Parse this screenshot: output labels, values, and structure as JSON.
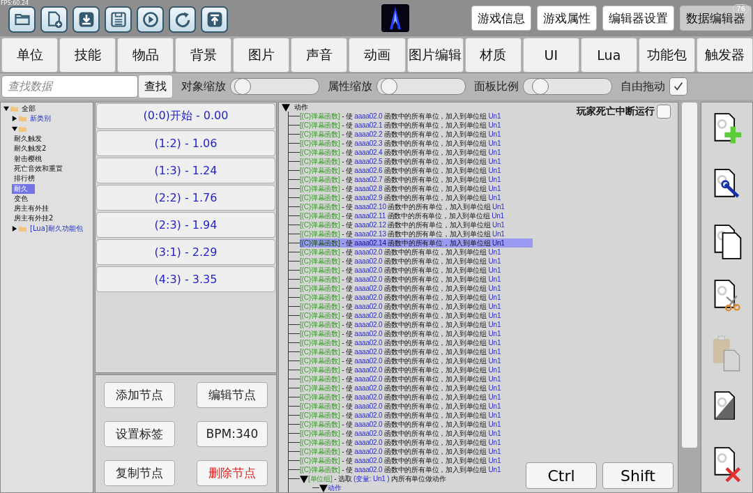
{
  "fps": "FPS:60.24",
  "toolbar": {
    "badge": "76",
    "tool_buttons": [
      {
        "kind": "folder"
      },
      {
        "kind": "new-file"
      },
      {
        "kind": "download"
      },
      {
        "kind": "save"
      },
      {
        "kind": "play"
      },
      {
        "kind": "refresh"
      },
      {
        "kind": "upload"
      }
    ],
    "nav_buttons": [
      {
        "label": "游戏信息",
        "selected": false
      },
      {
        "label": "游戏属性",
        "selected": false
      },
      {
        "label": "编辑器设置",
        "selected": false
      },
      {
        "label": "数据编辑器",
        "selected": true
      }
    ]
  },
  "tabs": [
    {
      "label": "单位",
      "selected": false
    },
    {
      "label": "技能",
      "selected": false
    },
    {
      "label": "物品",
      "selected": false
    },
    {
      "label": "背景",
      "selected": false
    },
    {
      "label": "图片",
      "selected": false
    },
    {
      "label": "声音",
      "selected": false
    },
    {
      "label": "动画",
      "selected": false
    },
    {
      "label": "图片编辑",
      "selected": false
    },
    {
      "label": "材质",
      "selected": false
    },
    {
      "label": "UI",
      "selected": false
    },
    {
      "label": "Lua",
      "selected": false
    },
    {
      "label": "功能包",
      "selected": false
    },
    {
      "label": "触发器",
      "selected": false
    }
  ],
  "search": {
    "placeholder": "查找数据",
    "button": "查找"
  },
  "sliders": [
    {
      "label": "对象缩放",
      "level": 0.05
    },
    {
      "label": "属性缩放",
      "level": 0.05
    },
    {
      "label": "面板比例",
      "level": 0.12
    }
  ],
  "free_drag": {
    "label": "自由拖动",
    "checked": true
  },
  "tree": [
    {
      "label": "全部",
      "kind": "folder",
      "expanded": true,
      "selected": false,
      "children": [
        {
          "label": "新类别",
          "expanded": false,
          "kind": "folder",
          "selected": false
        },
        {
          "expanded": true,
          "kind": "folder",
          "selected": false,
          "children": [
            {
              "label": "耐久触发",
              "selected": false
            },
            {
              "label": "耐久触发2",
              "selected": false
            },
            {
              "label": "射击樱桃",
              "selected": false
            },
            {
              "label": "死亡音效和重置",
              "selected": false
            },
            {
              "label": "排行榜",
              "selected": false
            },
            {
              "label": "耐久",
              "selected": true
            },
            {
              "label": "变色",
              "selected": false
            },
            {
              "label": "房主有外挂",
              "selected": false
            },
            {
              "label": "房主有外挂2",
              "selected": false
            }
          ]
        },
        {
          "label": "[Lua]耐久功能包",
          "expanded": false,
          "kind": "folder",
          "selected": false
        }
      ]
    }
  ],
  "nodes": [
    "(0:0)开始 - 0.00",
    "(1:2) - 1.06",
    "(1:3) - 1.24",
    "(2:2) - 1.76",
    "(2:3) - 1.94",
    "(3:1) - 2.29",
    "(4:3) - 3.35"
  ],
  "node_buttons": [
    {
      "label": "添加节点",
      "kind": "normal"
    },
    {
      "label": "编辑节点",
      "kind": "normal"
    },
    {
      "label": "设置标签",
      "kind": "normal"
    },
    {
      "label": "BPM:340",
      "kind": "normal"
    },
    {
      "label": "复制节点",
      "kind": "normal"
    },
    {
      "label": "删除节点",
      "kind": "danger"
    }
  ],
  "trigger": {
    "header": "动作",
    "stop_on_death": {
      "label": "玩家死亡中断运行",
      "checked": false
    },
    "rows": [
      {
        "tag": "[(C)弹幕函数]",
        "verb": " - 使 ",
        "target": "aaaa02.0",
        "rest": " 函数中的所有单位，加入到单位组 ",
        "group": "Un1",
        "selected": false
      },
      {
        "tag": "[(C)弹幕函数]",
        "verb": " - 使 ",
        "target": "aaaa02.1",
        "rest": " 函数中的所有单位，加入到单位组 ",
        "group": "Un1",
        "selected": false
      },
      {
        "tag": "[(C)弹幕函数]",
        "verb": " - 使 ",
        "target": "aaaa02.2",
        "rest": " 函数中的所有单位，加入到单位组 ",
        "group": "Un1",
        "selected": false
      },
      {
        "tag": "[(C)弹幕函数]",
        "verb": " - 使 ",
        "target": "aaaa02.3",
        "rest": " 函数中的所有单位，加入到单位组 ",
        "group": "Un1",
        "selected": false
      },
      {
        "tag": "[(C)弹幕函数]",
        "verb": " - 使 ",
        "target": "aaaa02.4",
        "rest": " 函数中的所有单位，加入到单位组 ",
        "group": "Un1",
        "selected": false
      },
      {
        "tag": "[(C)弹幕函数]",
        "verb": " - 使 ",
        "target": "aaaa02.5",
        "rest": " 函数中的所有单位，加入到单位组 ",
        "group": "Un1",
        "selected": false
      },
      {
        "tag": "[(C)弹幕函数]",
        "verb": " - 使 ",
        "target": "aaaa02.6",
        "rest": " 函数中的所有单位，加入到单位组 ",
        "group": "Un1",
        "selected": false
      },
      {
        "tag": "[(C)弹幕函数]",
        "verb": " - 使 ",
        "target": "aaaa02.7",
        "rest": " 函数中的所有单位，加入到单位组 ",
        "group": "Un1",
        "selected": false
      },
      {
        "tag": "[(C)弹幕函数]",
        "verb": " - 使 ",
        "target": "aaaa02.8",
        "rest": " 函数中的所有单位，加入到单位组 ",
        "group": "Un1",
        "selected": false
      },
      {
        "tag": "[(C)弹幕函数]",
        "verb": " - 使 ",
        "target": "aaaa02.9",
        "rest": " 函数中的所有单位，加入到单位组 ",
        "group": "Un1",
        "selected": false
      },
      {
        "tag": "[(C)弹幕函数]",
        "verb": " - 使 ",
        "target": "aaaa02.10",
        "rest": " 函数中的所有单位，加入到单位组 ",
        "group": "Un1",
        "selected": false
      },
      {
        "tag": "[(C)弹幕函数]",
        "verb": " - 使 ",
        "target": "aaaa02.11",
        "rest": " 函数中的所有单位，加入到单位组 ",
        "group": "Un1",
        "selected": false
      },
      {
        "tag": "[(C)弹幕函数]",
        "verb": " - 使 ",
        "target": "aaaa02.12",
        "rest": " 函数中的所有单位，加入到单位组 ",
        "group": "Un1",
        "selected": false
      },
      {
        "tag": "[(C)弹幕函数]",
        "verb": " - 使 ",
        "target": "aaaa02.13",
        "rest": " 函数中的所有单位，加入到单位组 ",
        "group": "Un1",
        "selected": false
      },
      {
        "tag": "[(C)弹幕函数]",
        "verb": " - 使 ",
        "target": "aaaa02.14",
        "rest": " 函数中的所有单位，加入到单位组 ",
        "group": "Un1",
        "selected": true
      },
      {
        "tag": "[(C)弹幕函数]",
        "verb": " - 使 ",
        "target": "aaaa02.0",
        "rest": " 函数中的所有单位，加入到单位组 ",
        "group": "Un1",
        "selected": false
      },
      {
        "tag": "[(C)弹幕函数]",
        "verb": " - 使 ",
        "target": "aaaa02.0",
        "rest": " 函数中的所有单位，加入到单位组 ",
        "group": "Un1",
        "selected": false
      },
      {
        "tag": "[(C)弹幕函数]",
        "verb": " - 使 ",
        "target": "aaaa02.0",
        "rest": " 函数中的所有单位，加入到单位组 ",
        "group": "Un1",
        "selected": false
      },
      {
        "tag": "[(C)弹幕函数]",
        "verb": " - 使 ",
        "target": "aaaa02.0",
        "rest": " 函数中的所有单位，加入到单位组 ",
        "group": "Un1",
        "selected": false
      },
      {
        "tag": "[(C)弹幕函数]",
        "verb": " - 使 ",
        "target": "aaaa02.0",
        "rest": " 函数中的所有单位，加入到单位组 ",
        "group": "Un1",
        "selected": false
      },
      {
        "tag": "[(C)弹幕函数]",
        "verb": " - 使 ",
        "target": "aaaa02.0",
        "rest": " 函数中的所有单位，加入到单位组 ",
        "group": "Un1",
        "selected": false
      },
      {
        "tag": "[(C)弹幕函数]",
        "verb": " - 使 ",
        "target": "aaaa02.0",
        "rest": " 函数中的所有单位，加入到单位组 ",
        "group": "Un1",
        "selected": false
      },
      {
        "tag": "[(C)弹幕函数]",
        "verb": " - 使 ",
        "target": "aaaa02.0",
        "rest": " 函数中的所有单位，加入到单位组 ",
        "group": "Un1",
        "selected": false
      },
      {
        "tag": "[(C)弹幕函数]",
        "verb": " - 使 ",
        "target": "aaaa02.0",
        "rest": " 函数中的所有单位，加入到单位组 ",
        "group": "Un1",
        "selected": false
      },
      {
        "tag": "[(C)弹幕函数]",
        "verb": " - 使 ",
        "target": "aaaa02.0",
        "rest": " 函数中的所有单位，加入到单位组 ",
        "group": "Un1",
        "selected": false
      },
      {
        "tag": "[(C)弹幕函数]",
        "verb": " - 使 ",
        "target": "aaaa02.0",
        "rest": " 函数中的所有单位，加入到单位组 ",
        "group": "Un1",
        "selected": false
      },
      {
        "tag": "[(C)弹幕函数]",
        "verb": " - 使 ",
        "target": "aaaa02.0",
        "rest": " 函数中的所有单位，加入到单位组 ",
        "group": "Un1",
        "selected": false
      },
      {
        "tag": "[(C)弹幕函数]",
        "verb": " - 使 ",
        "target": "aaaa02.0",
        "rest": " 函数中的所有单位，加入到单位组 ",
        "group": "Un1",
        "selected": false
      },
      {
        "tag": "[(C)弹幕函数]",
        "verb": " - 使 ",
        "target": "aaaa02.0",
        "rest": " 函数中的所有单位，加入到单位组 ",
        "group": "Un1",
        "selected": false
      },
      {
        "tag": "[(C)弹幕函数]",
        "verb": " - 使 ",
        "target": "aaaa02.0",
        "rest": " 函数中的所有单位，加入到单位组 ",
        "group": "Un1",
        "selected": false
      },
      {
        "tag": "[(C)弹幕函数]",
        "verb": " - 使 ",
        "target": "aaaa02.0",
        "rest": " 函数中的所有单位，加入到单位组 ",
        "group": "Un1",
        "selected": false
      },
      {
        "tag": "[(C)弹幕函数]",
        "verb": " - 使 ",
        "target": "aaaa02.0",
        "rest": " 函数中的所有单位，加入到单位组 ",
        "group": "Un1",
        "selected": false
      },
      {
        "tag": "[(C)弹幕函数]",
        "verb": " - 使 ",
        "target": "aaaa02.0",
        "rest": " 函数中的所有单位，加入到单位组 ",
        "group": "Un1",
        "selected": false
      },
      {
        "tag": "[(C)弹幕函数]",
        "verb": " - 使 ",
        "target": "aaaa02.0",
        "rest": " 函数中的所有单位，加入到单位组 ",
        "group": "Un1",
        "selected": false
      },
      {
        "tag": "[(C)弹幕函数]",
        "verb": " - 使 ",
        "target": "aaaa02.0",
        "rest": " 函数中的所有单位，加入到单位组 ",
        "group": "Un1",
        "selected": false
      },
      {
        "tag": "[(C)弹幕函数]",
        "verb": " - 使 ",
        "target": "aaaa02.0",
        "rest": " 函数中的所有单位，加入到单位组 ",
        "group": "Un1",
        "selected": false
      },
      {
        "tag": "[(C)弹幕函数]",
        "verb": " - 使 ",
        "target": "aaaa02.0",
        "rest": " 函数中的所有单位，加入到单位组 ",
        "group": "Un1",
        "selected": false
      },
      {
        "tag": "[(C)弹幕函数]",
        "verb": " - 使 ",
        "target": "aaaa02.0",
        "rest": " 函数中的所有单位，加入到单位组 ",
        "group": "Un1",
        "selected": false
      },
      {
        "tag": "[(C)弹幕函数]",
        "verb": " - 使 ",
        "target": "aaaa02.0",
        "rest": " 函数中的所有单位，加入到单位组 ",
        "group": "Un1",
        "selected": false
      },
      {
        "tag": "[(C)弹幕函数]",
        "verb": " - 使 ",
        "target": "aaaa02.0",
        "rest": " 函数中的所有单位，加入到单位组 ",
        "group": "Un1",
        "selected": false
      }
    ],
    "group_row": {
      "tag": "[单位组]",
      "verb": " - 选取 ",
      "target": "(变量: Un1 )",
      "rest": " 内所有单位做动作"
    },
    "child": "动作"
  },
  "keys": [
    "Ctrl",
    "Shift"
  ],
  "tools": [
    {
      "kind": "add"
    },
    {
      "kind": "edit"
    },
    {
      "kind": "copy"
    },
    {
      "kind": "cut"
    },
    {
      "kind": "paste",
      "disabled": true
    },
    {
      "kind": "half"
    },
    {
      "kind": "delete"
    }
  ]
}
